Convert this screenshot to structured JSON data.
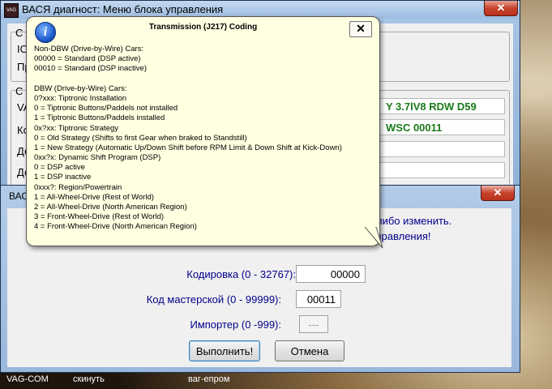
{
  "main_window": {
    "title": "ВАСЯ диагност: Меню блока управления",
    "app_icon_text": "VAG",
    "close_glyph": "✕",
    "side_labels": [
      "С",
      "IC",
      "Пр",
      "С",
      "VA",
      "Ко",
      "До",
      "До"
    ],
    "values": [
      "Y  3.7lV8 RDW D59",
      "WSC 00011",
      "",
      ""
    ]
  },
  "dialog": {
    "title": "ВАС",
    "close_glyph": "✕",
    "message_line1": "либо изменить.",
    "message_line2": "управления!",
    "coding_label": "Кодировка (0 - 32767):",
    "coding_value": "00000",
    "workshop_label": "Код мастерской (0 - 99999):",
    "workshop_value": "00011",
    "importer_label": "Импортер (0 -999):",
    "importer_value": "---",
    "execute_button": "Выполнить!",
    "cancel_button": "Отмена"
  },
  "balloon": {
    "title": "Transmission (J217) Coding",
    "icon_glyph": "i",
    "close_glyph": "✕",
    "lines": [
      "Non-DBW (Drive-by-Wire) Cars:",
      "00000 = Standard (DSP active)",
      "00010 = Standard (DSP inactive)",
      "",
      "DBW (Drive-by-Wire) Cars:",
      "0?xxx:  Tiptronic Installation",
      "0 = Tiptronic Buttons/Paddels not installed",
      "1 = Tiptronic Buttons/Paddels installed",
      "0x?xx:  Tiptronic Strategy",
      "0 = Old Strategy (Shifts to first Gear when braked to Standstill)",
      "1 = New Strategy (Automatic Up/Down Shift before RPM Limit & Down Shift at Kick-Down)",
      "0xx?x: Dynamic Shift Program (DSP)",
      "0 = DSP active",
      "1 = DSP inactive",
      "0xxx?:  Region/Powertrain",
      "1 = All-Wheel-Drive (Rest of World)",
      "2 = All-Wheel-Drive (North American Region)",
      "3 = Front-Wheel-Drive (Rest of World)",
      "4 = Front-Wheel-Drive (North American Region)"
    ]
  },
  "taskbar": {
    "items": [
      "VAG-COM",
      "скинуть",
      "ваг-епром"
    ]
  }
}
